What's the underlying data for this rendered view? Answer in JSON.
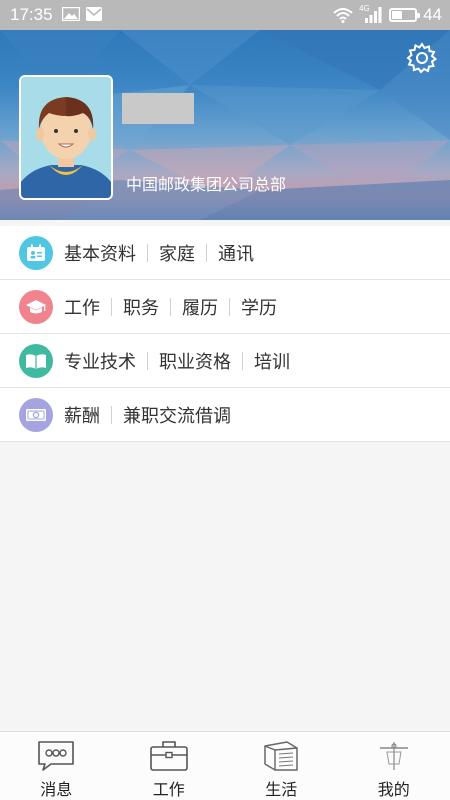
{
  "status_bar": {
    "time": "17:35",
    "network": "4G",
    "battery_level": "44",
    "battery_fraction": 0.44,
    "icons": [
      "image-icon",
      "mail-icon",
      "wifi-icon",
      "signal-icon",
      "battery-icon"
    ]
  },
  "profile": {
    "organization": "中国邮政集团公司总部",
    "name_redacted": true
  },
  "menu": [
    {
      "icon": "id-card-icon",
      "color": "#4fc6e2",
      "items": [
        "基本资料",
        "家庭",
        "通讯"
      ]
    },
    {
      "icon": "graduation-cap-icon",
      "color": "#f0838d",
      "items": [
        "工作",
        "职务",
        "履历",
        "学历"
      ]
    },
    {
      "icon": "book-icon",
      "color": "#3fb9a0",
      "items": [
        "专业技术",
        "职业资格",
        "培训"
      ]
    },
    {
      "icon": "money-icon",
      "color": "#a5a4e0",
      "items": [
        "薪酬",
        "兼职交流借调"
      ]
    }
  ],
  "tabbar": {
    "tabs": [
      {
        "label": "消息",
        "icon": "chat-bubble-icon"
      },
      {
        "label": "工作",
        "icon": "briefcase-icon"
      },
      {
        "label": "生活",
        "icon": "books-icon"
      },
      {
        "label": "我的",
        "icon": "person-icon"
      }
    ]
  }
}
